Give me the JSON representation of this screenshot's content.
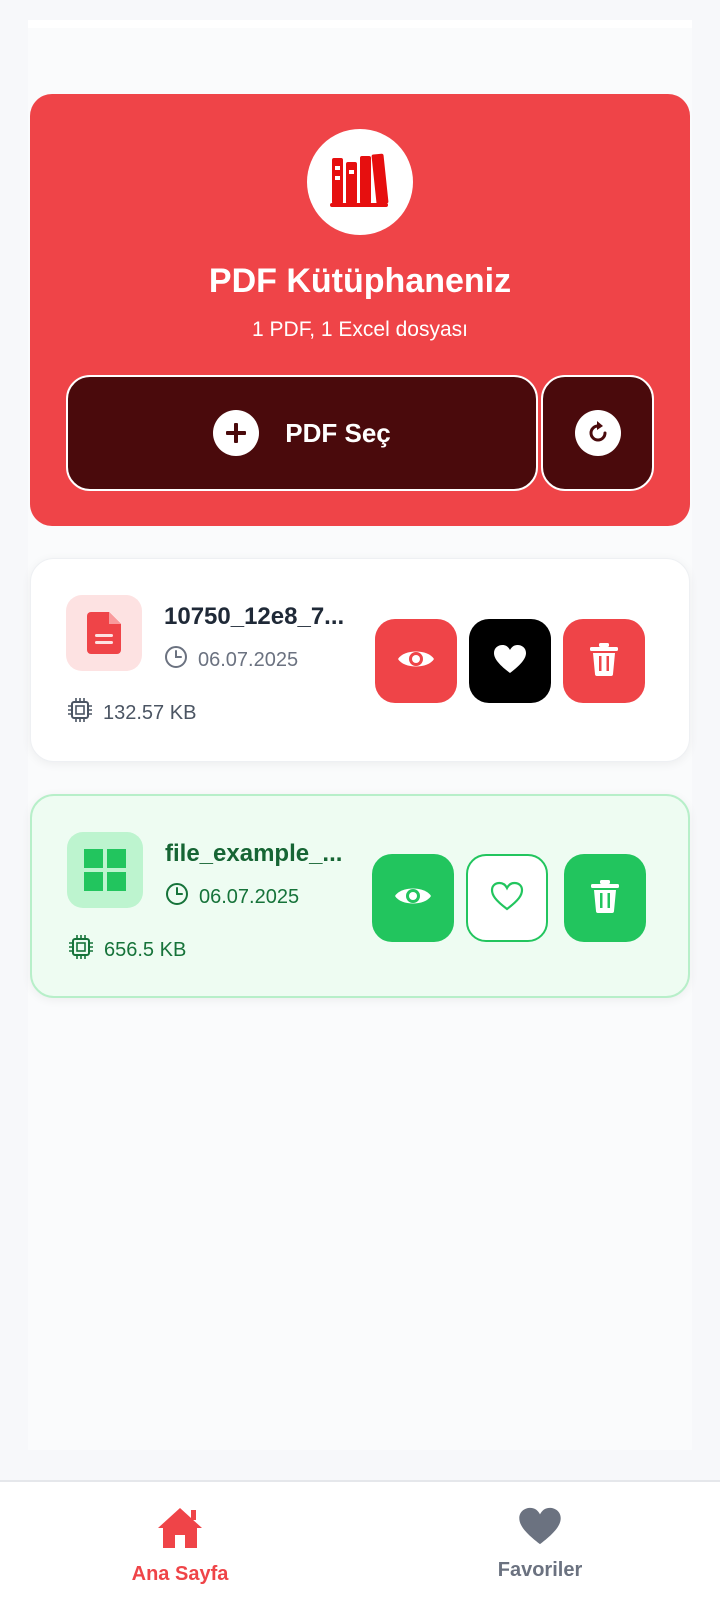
{
  "header": {
    "title": "PDF Kütüphaneniz",
    "subtitle": "1 PDF, 1 Excel dosyası",
    "pick_button_label": "PDF Seç",
    "logo_icon": "library-books-icon",
    "refresh_icon": "refresh-icon"
  },
  "files": [
    {
      "name": "10750_12e8_7...",
      "date": "06.07.2025",
      "size": "132.57 KB",
      "type": "pdf",
      "favorite": true,
      "icons": [
        "pdf-file-icon",
        "clock-icon",
        "chip-icon",
        "eye-icon",
        "heart-icon",
        "trash-icon"
      ]
    },
    {
      "name": "file_example_...",
      "date": "06.07.2025",
      "size": "656.5 KB",
      "type": "excel",
      "favorite": false,
      "icons": [
        "excel-grid-icon",
        "clock-icon",
        "chip-icon",
        "eye-icon",
        "heart-outline-icon",
        "trash-icon"
      ]
    }
  ],
  "nav": {
    "home_label": "Ana Sayfa",
    "favorites_label": "Favoriler",
    "active": "home"
  },
  "colors": {
    "accent": "#ef4448",
    "dark": "#4a0a0c",
    "green": "#22c55e"
  }
}
